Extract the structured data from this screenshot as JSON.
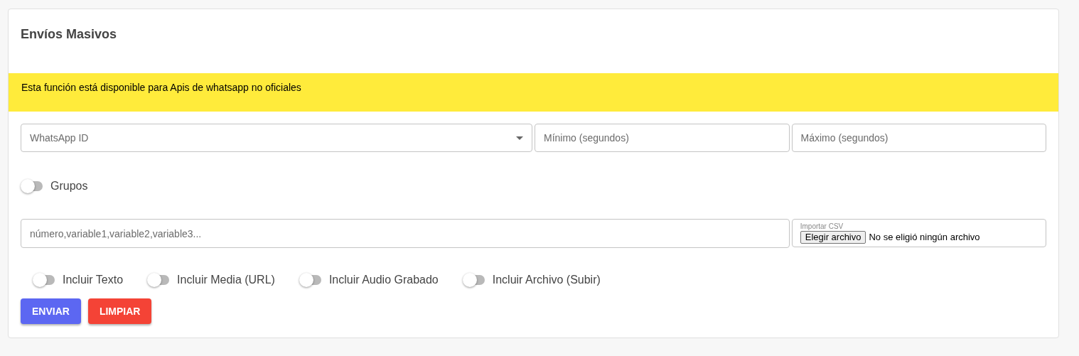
{
  "title": "Envíos Masivos",
  "notice": "Esta función está disponible para Apis de whatsapp no oficiales",
  "fields": [
    {
      "kind": "select",
      "placeholder": "WhatsApp ID"
    },
    {
      "kind": "text",
      "placeholder": "Mínimo (segundos)"
    },
    {
      "kind": "text",
      "placeholder": "Máximo (segundos)"
    }
  ],
  "groups_toggle": {
    "label": "Grupos",
    "on": false
  },
  "numbers_field": {
    "placeholder": "número,variable1,variable2,variable3..."
  },
  "file_field": {
    "label": "Importar CSV",
    "button": "Elegir archivo",
    "status": "No se eligió ningún archivo"
  },
  "toggles": [
    {
      "label": "Incluir Texto",
      "on": false
    },
    {
      "label": "Incluir Media (URL)",
      "on": false
    },
    {
      "label": "Incluir Audio Grabado",
      "on": false
    },
    {
      "label": "Incluir Archivo (Subir)",
      "on": false
    }
  ],
  "buttons": [
    {
      "kind": "primary",
      "label": "ENVIAR"
    },
    {
      "kind": "danger",
      "label": "LIMPIAR"
    }
  ]
}
